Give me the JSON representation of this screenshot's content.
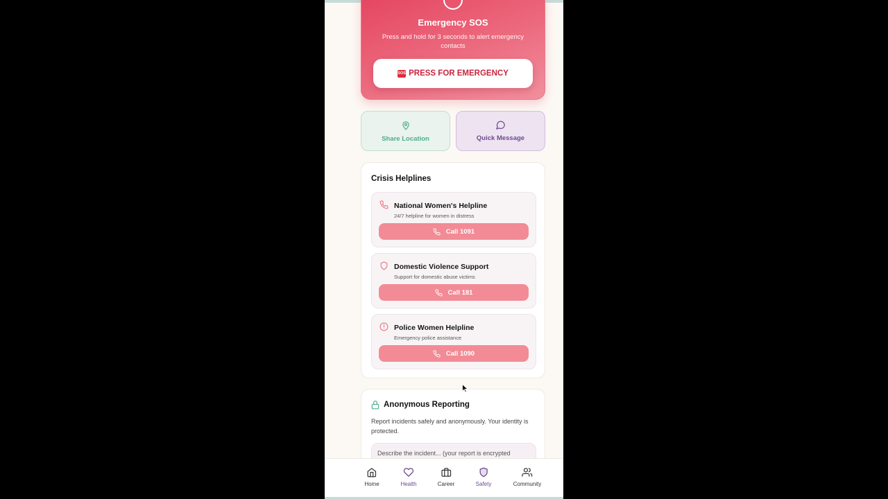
{
  "sos": {
    "title": "Emergency SOS",
    "description": "Press and hold for 3 seconds to alert emergency contacts",
    "badge": "SOS",
    "button_label": "PRESS FOR EMERGENCY"
  },
  "quick_actions": {
    "share_location": "Share Location",
    "quick_message": "Quick Message"
  },
  "helplines": {
    "title": "Crisis Helplines",
    "items": [
      {
        "name": "National Women's Helpline",
        "description": "24/7 helpline for women in distress",
        "call_label": "Call 1091",
        "icon": "phone-icon"
      },
      {
        "name": "Domestic Violence Support",
        "description": "Support for domestic abuse victims",
        "call_label": "Call 181",
        "icon": "shield-icon"
      },
      {
        "name": "Police Women Helpline",
        "description": "Emergency police assistance",
        "call_label": "Call 1090",
        "icon": "alert-circle-icon"
      }
    ]
  },
  "report": {
    "title": "Anonymous Reporting",
    "description": "Report incidents safely and anonymously. Your identity is protected.",
    "placeholder": "Describe the incident... (your report is encrypted"
  },
  "nav": {
    "items": [
      {
        "label": "Home",
        "icon": "home-icon"
      },
      {
        "label": "Health",
        "icon": "heart-icon"
      },
      {
        "label": "Career",
        "icon": "briefcase-icon"
      },
      {
        "label": "Safety",
        "icon": "shield-icon",
        "active": true
      },
      {
        "label": "Community",
        "icon": "users-icon"
      }
    ]
  },
  "colors": {
    "sos_gradient_start": "#e4435e",
    "sos_gradient_end": "#f1909e",
    "call_button": "#f28b96",
    "accent_purple": "#6c4a91",
    "accent_green": "#4bae8a"
  }
}
